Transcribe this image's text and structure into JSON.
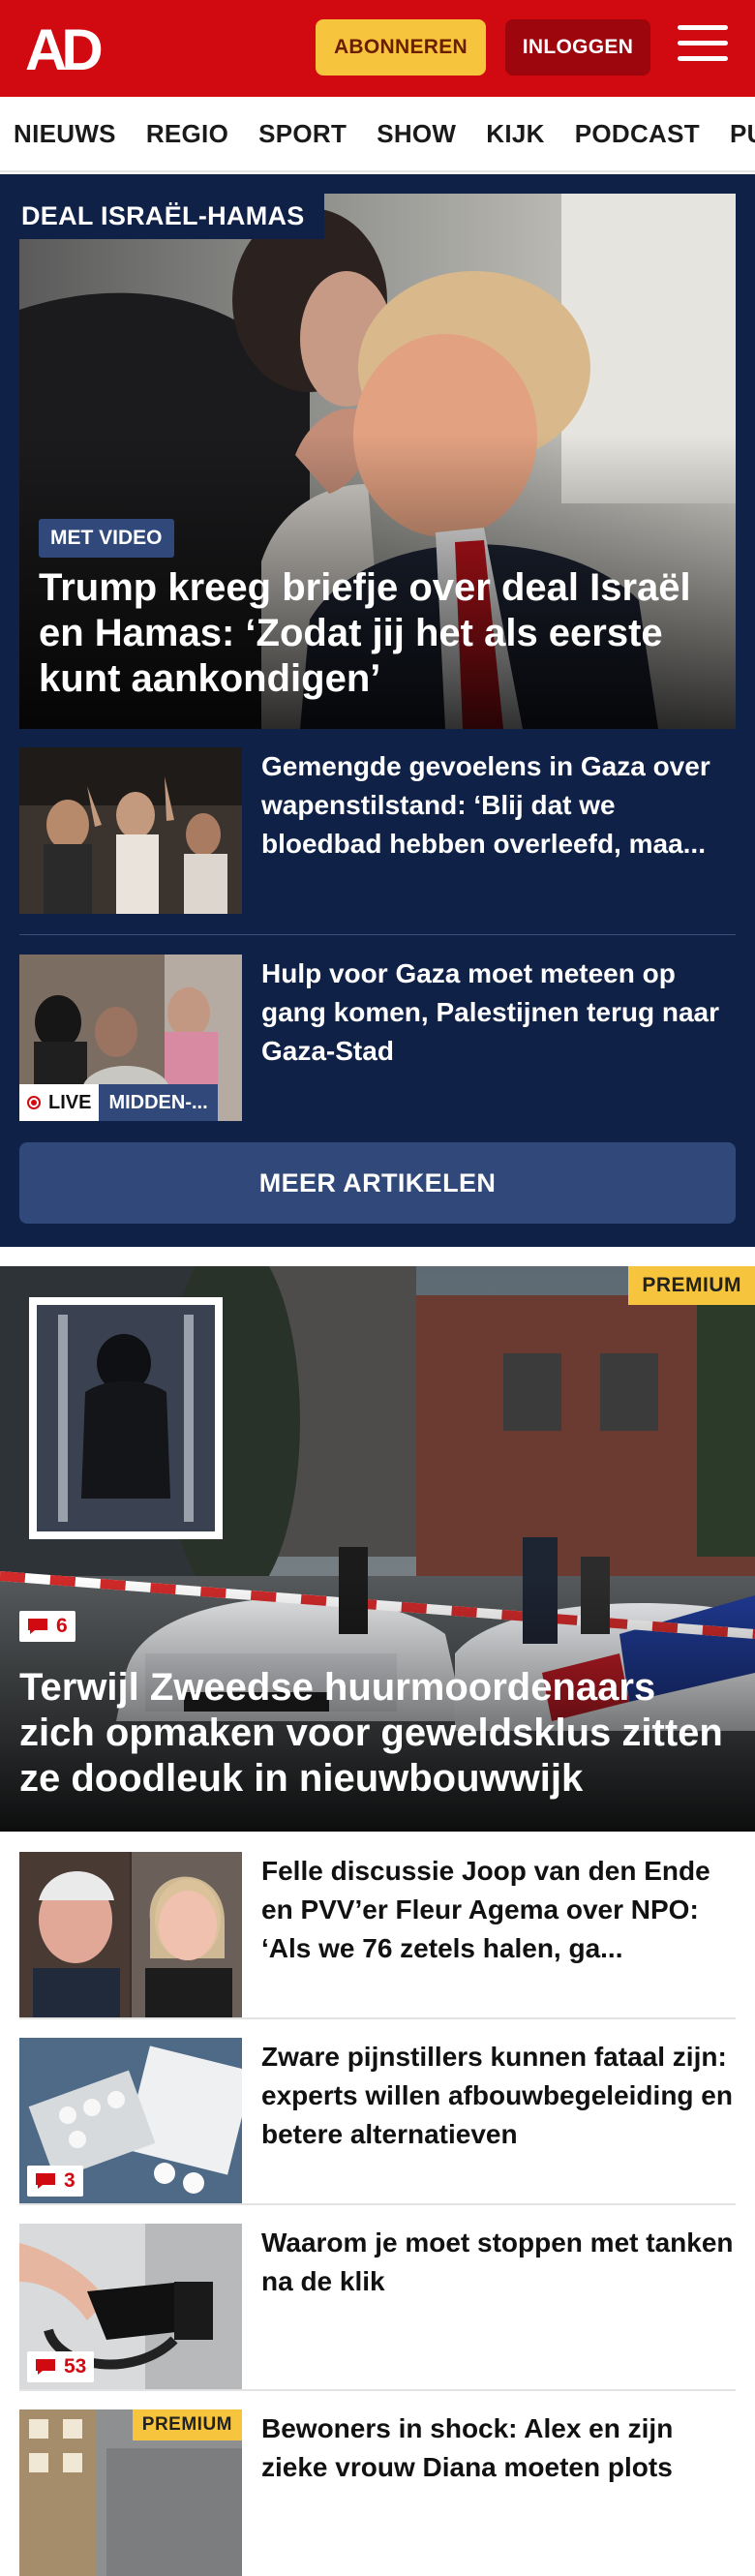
{
  "header": {
    "logo_text": "AD",
    "subscribe_label": "ABONNEREN",
    "login_label": "INLOGGEN",
    "brand_color": "#d10a11"
  },
  "nav": {
    "items": [
      "NIEUWS",
      "REGIO",
      "SPORT",
      "SHOW",
      "KIJK",
      "PODCAST",
      "PUZZ"
    ]
  },
  "topic": {
    "label": "DEAL ISRAËL-HAMAS",
    "hero": {
      "badge": "MET VIDEO",
      "title": "Trump kreeg briefje over deal Israël en Hamas: ‘Zodat jij het als eerste kunt aankondigen’"
    },
    "articles": [
      {
        "title": "Gemengde gevoelens in Gaza over wapenstilstand: ‘Blij dat we bloedbad hebben overleefd, maa..."
      },
      {
        "title": "Hulp voor Gaza moet meteen op gang komen, Palestijnen terug naar Gaza-Stad",
        "live_label": "LIVE",
        "live_topic": "MIDDEN-..."
      }
    ],
    "more_label": "MEER ARTIKELEN"
  },
  "feature": {
    "premium_label": "PREMIUM",
    "comments": "6",
    "title": "Terwijl Zweedse huurmoordenaars zich opmaken voor geweldsklus zitten ze doodleuk in nieuwbouwwijk"
  },
  "feed": [
    {
      "title": "Felle discussie Joop van den Ende en PVV’er Fleur Agema over NPO: ‘Als we 76 zetels halen, ga..."
    },
    {
      "title": "Zware pijnstillers kunnen fataal zijn: experts willen afbouwbege­leiding en betere alternatieven",
      "comments": "3"
    },
    {
      "title": "Waarom je moet stoppen met tanken na de klik",
      "comments": "53"
    },
    {
      "title": "Bewoners in shock: Alex en zijn zieke vrouw Diana moeten plots",
      "premium_label": "PREMIUM"
    }
  ]
}
